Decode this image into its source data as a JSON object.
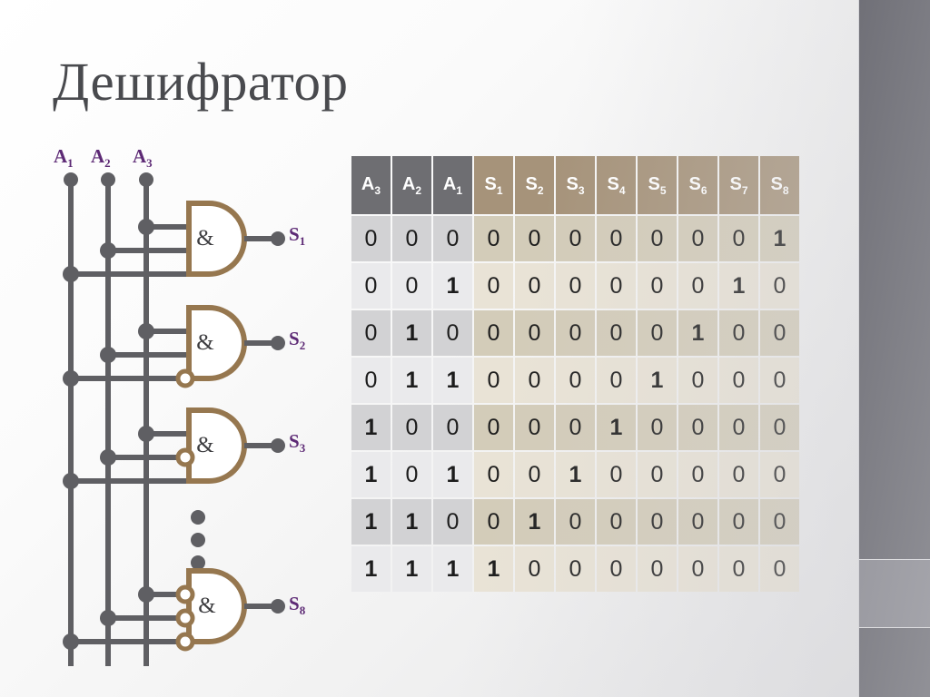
{
  "title": "Дешифратор",
  "circuit": {
    "inputs": [
      {
        "label": "A",
        "sub": "1"
      },
      {
        "label": "A",
        "sub": "2"
      },
      {
        "label": "A",
        "sub": "3"
      }
    ],
    "outputs": [
      {
        "label": "S",
        "sub": "1"
      },
      {
        "label": "S",
        "sub": "2"
      },
      {
        "label": "S",
        "sub": "3"
      },
      {
        "label": "S",
        "sub": "8"
      }
    ],
    "gate_symbol": "&",
    "gate_count_shown": 4,
    "ellipsis": "⋮",
    "colors": {
      "wire": "#5f5f63",
      "gate_outline": "#96774f",
      "label": "#5d2a75",
      "gate_fill": "#ffffff"
    },
    "gates": [
      {
        "output": "S1",
        "inverted_inputs": []
      },
      {
        "output": "S2",
        "inverted_inputs": [
          2
        ]
      },
      {
        "output": "S3",
        "inverted_inputs": [
          1
        ]
      },
      {
        "output": "S8",
        "inverted_inputs": [
          0,
          1,
          2
        ]
      }
    ]
  },
  "table": {
    "headers": [
      {
        "label": "A",
        "sub": "3",
        "group": "addr"
      },
      {
        "label": "A",
        "sub": "2",
        "group": "addr"
      },
      {
        "label": "A",
        "sub": "1",
        "group": "addr"
      },
      {
        "label": "S",
        "sub": "1",
        "group": "sel"
      },
      {
        "label": "S",
        "sub": "2",
        "group": "sel"
      },
      {
        "label": "S",
        "sub": "3",
        "group": "sel"
      },
      {
        "label": "S",
        "sub": "4",
        "group": "sel"
      },
      {
        "label": "S",
        "sub": "5",
        "group": "sel"
      },
      {
        "label": "S",
        "sub": "6",
        "group": "sel"
      },
      {
        "label": "S",
        "sub": "7",
        "group": "sel"
      },
      {
        "label": "S",
        "sub": "8",
        "group": "sel"
      }
    ],
    "rows": [
      {
        "addr": [
          "0",
          "0",
          "0"
        ],
        "sel": [
          "0",
          "0",
          "0",
          "0",
          "0",
          "0",
          "0",
          "1"
        ]
      },
      {
        "addr": [
          "0",
          "0",
          "1"
        ],
        "sel": [
          "0",
          "0",
          "0",
          "0",
          "0",
          "0",
          "1",
          "0"
        ]
      },
      {
        "addr": [
          "0",
          "1",
          "0"
        ],
        "sel": [
          "0",
          "0",
          "0",
          "0",
          "0",
          "1",
          "0",
          "0"
        ]
      },
      {
        "addr": [
          "0",
          "1",
          "1"
        ],
        "sel": [
          "0",
          "0",
          "0",
          "0",
          "1",
          "0",
          "0",
          "0"
        ]
      },
      {
        "addr": [
          "1",
          "0",
          "0"
        ],
        "sel": [
          "0",
          "0",
          "0",
          "1",
          "0",
          "0",
          "0",
          "0"
        ]
      },
      {
        "addr": [
          "1",
          "0",
          "1"
        ],
        "sel": [
          "0",
          "0",
          "1",
          "0",
          "0",
          "0",
          "0",
          "0"
        ]
      },
      {
        "addr": [
          "1",
          "1",
          "0"
        ],
        "sel": [
          "0",
          "1",
          "0",
          "0",
          "0",
          "0",
          "0",
          "0"
        ]
      },
      {
        "addr": [
          "1",
          "1",
          "1"
        ],
        "sel": [
          "1",
          "0",
          "0",
          "0",
          "0",
          "0",
          "0",
          "0"
        ]
      }
    ],
    "colors": {
      "header_addr": "#6e6e72",
      "header_sel": "#a6937a",
      "row_odd_addr": "#d2d2d4",
      "row_even_addr": "#eaeaec",
      "row_odd_sel": "#d3ccb9",
      "row_even_sel": "#e9e3d6"
    }
  },
  "decoration": {
    "sidebar_dark": "#41414a",
    "sidebar_light": "#6f6f78"
  }
}
